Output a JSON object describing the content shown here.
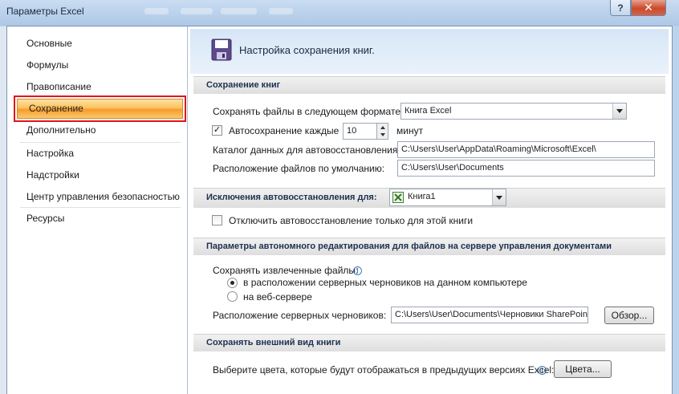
{
  "window": {
    "title": "Параметры Excel",
    "help_label": "?",
    "close_label": "✕"
  },
  "nav": {
    "items": [
      {
        "label": "Основные"
      },
      {
        "label": "Формулы"
      },
      {
        "label": "Правописание"
      },
      {
        "label": "Сохранение",
        "active": true
      },
      {
        "label": "Дополнительно"
      },
      {
        "label": "Настройка"
      },
      {
        "label": "Надстройки"
      },
      {
        "label": "Центр управления безопасностью"
      },
      {
        "label": "Ресурсы"
      }
    ]
  },
  "header": {
    "title": "Настройка сохранения книг."
  },
  "save_books": {
    "heading": "Сохранение книг",
    "format_label": "Сохранять файлы в следующем формате:",
    "format_value": "Книга Excel",
    "autosave_label": "Автосохранение каждые",
    "autosave_checked": true,
    "autosave_value": "10",
    "autosave_unit": "минут",
    "recovery_dir_label": "Каталог данных для автовосстановления:",
    "recovery_dir_value": "C:\\Users\\User\\AppData\\Roaming\\Microsoft\\Excel\\",
    "default_location_label": "Расположение файлов по умолчанию:",
    "default_location_value": "C:\\Users\\User\\Documents"
  },
  "exceptions": {
    "heading": "Исключения автовосстановления для:",
    "workbook_value": "Книга1",
    "disable_label": "Отключить автовосстановление только для этой книги",
    "disable_checked": false
  },
  "offline": {
    "heading": "Параметры автономного редактирования для файлов на сервере управления документами",
    "save_extracted_label": "Сохранять извлеченные файлы:",
    "option_local": "в расположении серверных черновиков на данном компьютере",
    "option_web": "на веб-сервере",
    "selected": "local",
    "drafts_label": "Расположение серверных черновиков:",
    "drafts_value": "C:\\Users\\User\\Documents\\Черновики SharePoint",
    "browse_label": "Обзор..."
  },
  "appearance": {
    "heading": "Сохранять внешний вид книги",
    "colors_label": "Выберите цвета, которые будут отображаться в предыдущих версиях Excel:",
    "colors_button": "Цвета..."
  },
  "icons": {
    "save_icon": "floppy-disk",
    "excel_icon": "excel-workbook",
    "info_icon": "info"
  },
  "colors": {
    "accent_active": "#f79a2c",
    "selection_border": "#e2141b",
    "section_text": "#1d3050"
  }
}
